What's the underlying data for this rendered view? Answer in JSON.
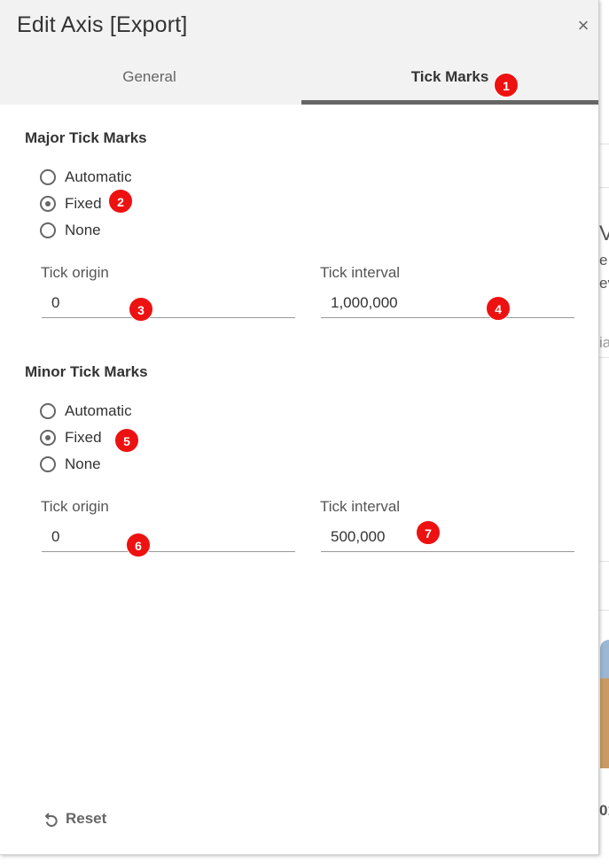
{
  "dialog": {
    "title": "Edit Axis [Export]",
    "close_glyph": "×",
    "tabs": [
      {
        "label": "General",
        "active": false
      },
      {
        "label": "Tick Marks",
        "active": true
      }
    ]
  },
  "major": {
    "title": "Major Tick Marks",
    "options": [
      {
        "label": "Automatic",
        "checked": false
      },
      {
        "label": "Fixed",
        "checked": true
      },
      {
        "label": "None",
        "checked": false
      }
    ],
    "origin_label": "Tick origin",
    "origin_value": "0",
    "interval_label": "Tick interval",
    "interval_value": "1,000,000"
  },
  "minor": {
    "title": "Minor Tick Marks",
    "options": [
      {
        "label": "Automatic",
        "checked": false
      },
      {
        "label": "Fixed",
        "checked": true
      },
      {
        "label": "None",
        "checked": false
      }
    ],
    "origin_label": "Tick origin",
    "origin_value": "0",
    "interval_label": "Tick interval",
    "interval_value": "500,000"
  },
  "footer": {
    "reset_label": "Reset"
  },
  "badges": [
    "1",
    "2",
    "3",
    "4",
    "5",
    "6",
    "7"
  ],
  "background_fragments": [
    "V",
    "e",
    "ev",
    "ia",
    "01"
  ],
  "colors": {
    "badge": "#ee1111",
    "tab_underline": "#666666",
    "header_bg": "#f2f2f2"
  }
}
